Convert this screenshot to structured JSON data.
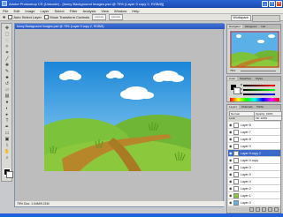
{
  "window": {
    "title": "Adobe Photoshop CS (Unicode) - [funny Background Images.psd @ 75% (Layer 9 copy 2, RGB/8)]",
    "minimize_glyph": "_",
    "maximize_glyph": "□",
    "close_glyph": "×"
  },
  "menu": [
    "File",
    "Edit",
    "Image",
    "Layer",
    "Select",
    "Filter",
    "Analysis",
    "View",
    "Window",
    "Help"
  ],
  "options_bar": {
    "auto_select_label": "Auto Select Layer",
    "show_transform_label": "Show Transform Controls",
    "workspace_label": "Workspace"
  },
  "document": {
    "title": "funny Background Images.psd @ 75% (Layer 9 copy 2, RGB/8)",
    "status": "75%   Doc: 1.04M/9.21M"
  },
  "navigator": {
    "tabs": [
      "Navigator",
      "Histogram",
      "Info"
    ],
    "zoom": "75%"
  },
  "color_panel": {
    "tabs": [
      "Color",
      "Swatches",
      "Styles"
    ],
    "channels": [
      "R",
      "G",
      "B"
    ]
  },
  "layers_panel": {
    "tabs": [
      "Layers",
      "Channels",
      "Paths"
    ],
    "blend_mode": "Normal",
    "opacity_label": "Opacity: 100%",
    "fill_label": "Fill: 100%",
    "lock_label": "Lock:",
    "layers": [
      {
        "name": "Layer 6",
        "selected": false
      },
      {
        "name": "Layer 7",
        "selected": false
      },
      {
        "name": "Layer 8",
        "selected": false
      },
      {
        "name": "Layer 9",
        "selected": false
      },
      {
        "name": "Layer 9 copy 2",
        "selected": true
      },
      {
        "name": "Layer 9 copy",
        "selected": false
      },
      {
        "name": "Layer 3",
        "selected": false
      },
      {
        "name": "Layer 5",
        "selected": false
      },
      {
        "name": "Layer 4",
        "selected": false
      },
      {
        "name": "Layer 2",
        "selected": false
      },
      {
        "name": "Layer 1",
        "selected": false
      },
      {
        "name": "Layer 0",
        "selected": false
      }
    ]
  },
  "colors": {
    "sky_top": "#1a86d8",
    "sky_bottom": "#9bd6f4",
    "grass_light": "#8cc83c",
    "grass_dark": "#5aa42a",
    "path": "#b8862a",
    "selection": "#3a68c8"
  }
}
